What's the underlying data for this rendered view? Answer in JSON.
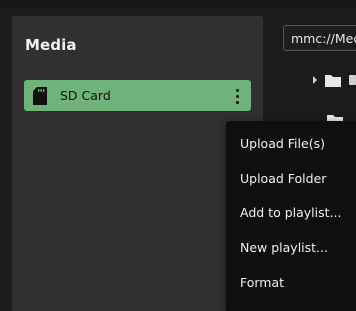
{
  "sidebar": {
    "title": "Media",
    "items": [
      {
        "label": "SD Card",
        "icon": "sd-card-icon",
        "selected": true
      }
    ],
    "accent_color": "#6fb27b"
  },
  "main": {
    "path": "mmc://Media"
  },
  "context_menu": {
    "items": [
      {
        "label": "Upload File(s)"
      },
      {
        "label": "Upload Folder"
      },
      {
        "label": "Add to playlist..."
      },
      {
        "label": "New playlist..."
      },
      {
        "label": "Format"
      }
    ]
  }
}
